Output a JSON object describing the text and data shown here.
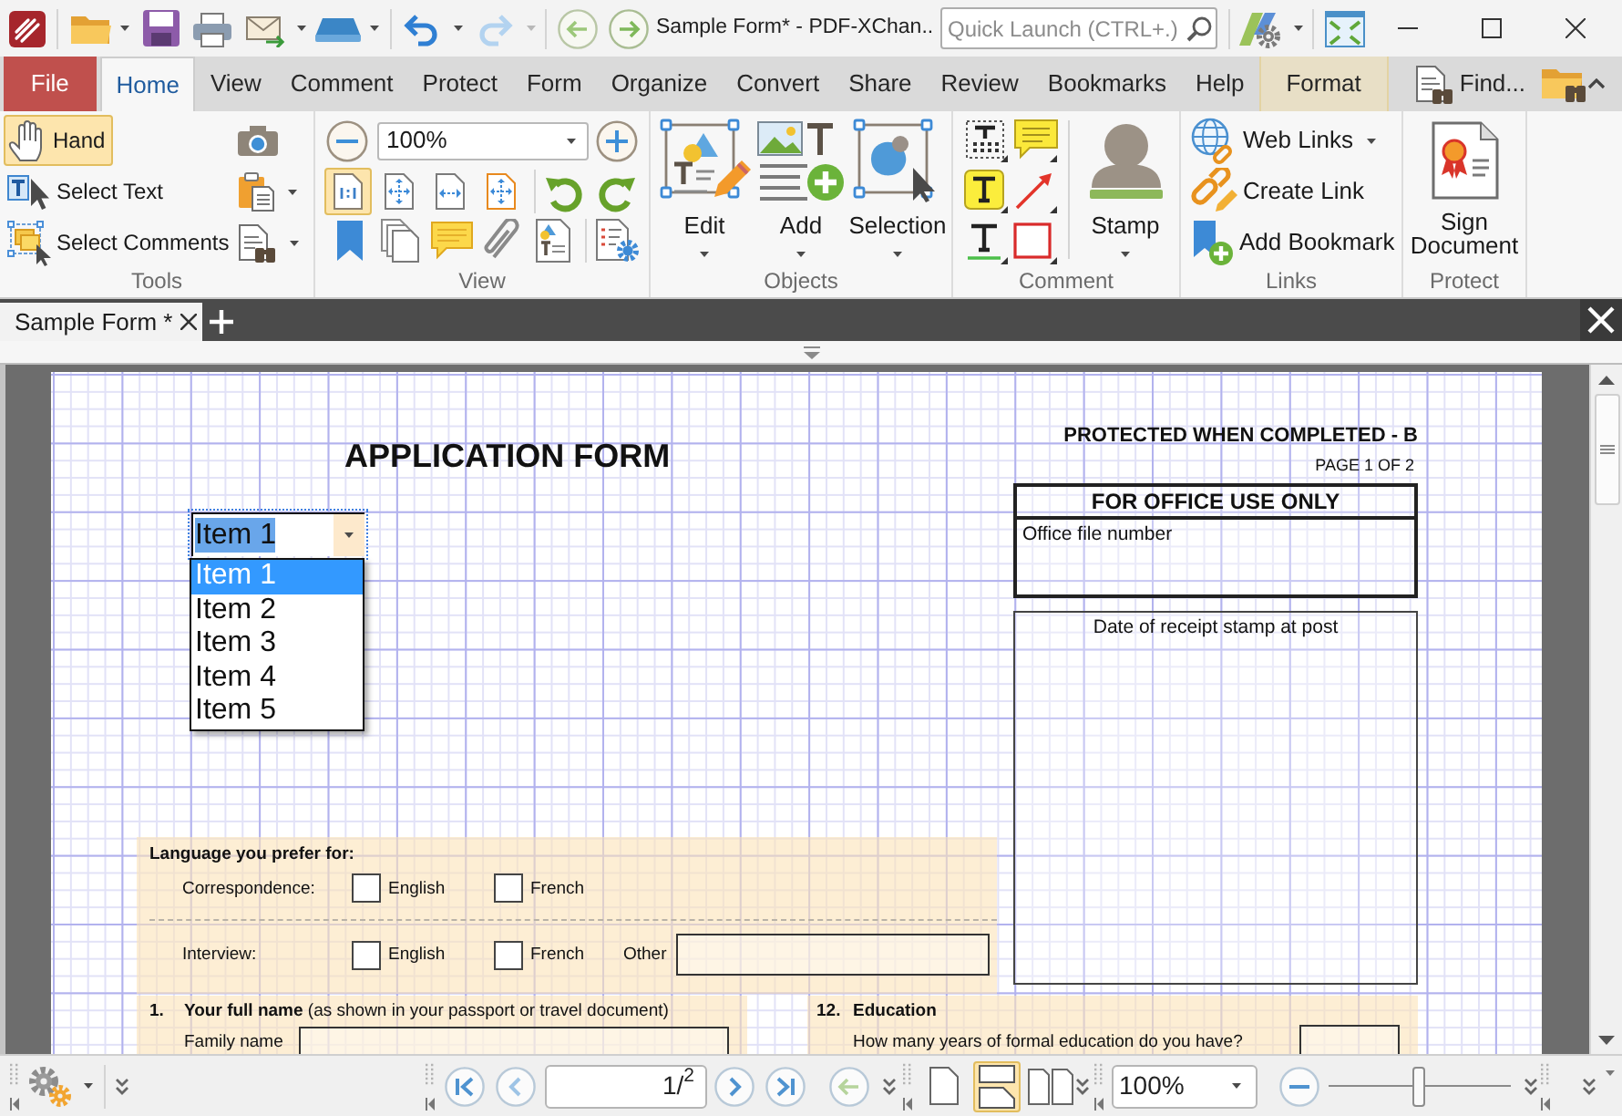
{
  "title_bar": {
    "title": "Sample Form* - PDF-XChan..",
    "quick_launch": {
      "placeholder": "Quick Launch (CTRL+.)"
    },
    "history": [
      {
        "kind": "undo",
        "disabled": false
      },
      {
        "kind": "redo",
        "disabled": true
      }
    ]
  },
  "ribbon_tabs": [
    {
      "label": "File",
      "kind": "file",
      "selected": false
    },
    {
      "label": "Home",
      "kind": "tab",
      "selected": true
    },
    {
      "label": "View",
      "kind": "tab",
      "selected": false
    },
    {
      "label": "Comment",
      "kind": "tab",
      "selected": false
    },
    {
      "label": "Protect",
      "kind": "tab",
      "selected": false
    },
    {
      "label": "Form",
      "kind": "tab",
      "selected": false
    },
    {
      "label": "Organize",
      "kind": "tab",
      "selected": false
    },
    {
      "label": "Convert",
      "kind": "tab",
      "selected": false
    },
    {
      "label": "Share",
      "kind": "tab",
      "selected": false
    },
    {
      "label": "Review",
      "kind": "tab",
      "selected": false
    },
    {
      "label": "Bookmarks",
      "kind": "tab",
      "selected": false
    },
    {
      "label": "Help",
      "kind": "tab",
      "selected": false
    },
    {
      "label": "Format",
      "kind": "context",
      "selected": false
    }
  ],
  "find": {
    "label": "Find..."
  },
  "tools_group": {
    "label": "Tools",
    "tools": [
      {
        "label": "Hand",
        "kind": "hand",
        "selected": true
      },
      {
        "label": "Select Text",
        "kind": "select-text",
        "selected": false
      },
      {
        "label": "Select Comments",
        "kind": "select-comments",
        "selected": false
      }
    ]
  },
  "view_group": {
    "label": "View",
    "zoom": "100%",
    "view_modes": [
      {
        "kind": "actual-size",
        "selected": true
      },
      {
        "kind": "fit-page",
        "selected": false
      },
      {
        "kind": "fit-width",
        "selected": false
      },
      {
        "kind": "fit-visible",
        "selected": false
      }
    ]
  },
  "objects_group": {
    "label": "Objects",
    "buttons": [
      {
        "label": "Edit",
        "kind": "edit"
      },
      {
        "label": "Add",
        "kind": "add"
      },
      {
        "label": "Selection",
        "kind": "selection"
      }
    ]
  },
  "comment_group": {
    "label": "Comment",
    "stamp": "Stamp"
  },
  "links_group": {
    "label": "Links",
    "buttons": [
      {
        "label": "Web Links",
        "kind": "web-links",
        "dropdown": true
      },
      {
        "label": "Create Link",
        "kind": "create-link",
        "dropdown": false
      },
      {
        "label": "Add Bookmark",
        "kind": "add-bookmark",
        "dropdown": false
      }
    ]
  },
  "protect_group": {
    "label": "Protect",
    "button": "Sign Document"
  },
  "document_tabs": [
    {
      "label": "Sample Form *",
      "selected": true
    }
  ],
  "form": {
    "title": "APPLICATION FORM",
    "protection": "PROTECTED WHEN COMPLETED - B",
    "page_label": "PAGE 1 OF 2",
    "office_box": {
      "heading": "FOR OFFICE USE ONLY",
      "label": "Office file number"
    },
    "stamp_box": {
      "label": "Date of receipt stamp at post"
    },
    "combo": {
      "value": "Item 1",
      "expanded": true,
      "options": [
        {
          "label": "Item 1",
          "selected": true
        },
        {
          "label": "Item 2",
          "selected": false
        },
        {
          "label": "Item 3",
          "selected": false
        },
        {
          "label": "Item 4",
          "selected": false
        },
        {
          "label": "Item 5",
          "selected": false
        }
      ]
    },
    "language": {
      "heading": "Language you prefer for:",
      "rows": [
        {
          "label": "Correspondence:",
          "options": [
            {
              "label": "English",
              "checked": false
            },
            {
              "label": "French",
              "checked": false
            }
          ]
        },
        {
          "label": "Interview:",
          "options": [
            {
              "label": "English",
              "checked": false
            },
            {
              "label": "French",
              "checked": false
            }
          ],
          "other": "Other"
        }
      ]
    },
    "full_name": {
      "number": "1.",
      "heading": "**Your full name** (as shown in your passport or travel document)",
      "family_name": "Family name"
    },
    "education": {
      "number": "12.",
      "heading": "Education",
      "question": "How many years of formal education do you have?"
    }
  },
  "status_bar": {
    "page": "1/$^{2}$",
    "zoom": "100%",
    "zoom_slider": {
      "level": 0.49
    },
    "page_layouts": [
      {
        "kind": "single",
        "selected": false
      },
      {
        "kind": "continuous",
        "selected": true
      },
      {
        "kind": "facing",
        "selected": false
      }
    ]
  }
}
